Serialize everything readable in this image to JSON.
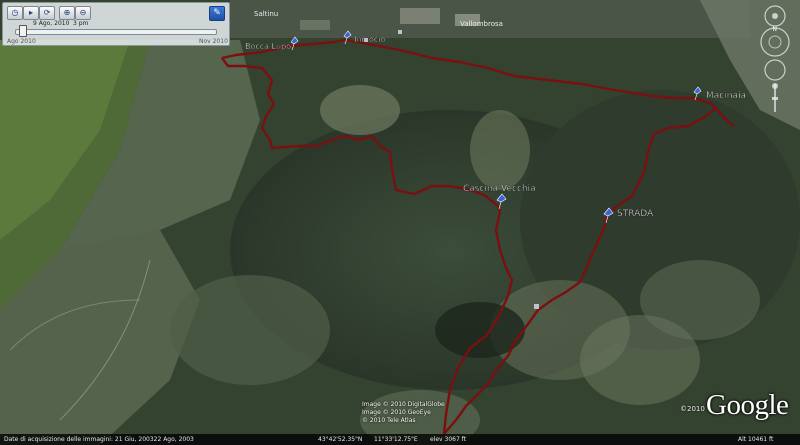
{
  "time_slider": {
    "date": "9 Ago, 2010",
    "time": "3 pm",
    "start_label": "Ago 2010",
    "end_label": "Nov 2010"
  },
  "places": {
    "sallinu": "Saltinu",
    "vallombrosa": "Vallombrosa"
  },
  "placemarks": [
    {
      "label": "Bocca Lupo"
    },
    {
      "label": "Incrocio"
    },
    {
      "label": "Macinaia"
    },
    {
      "label": "Cascina Vecchia"
    },
    {
      "label": "STRADA"
    }
  ],
  "credits": {
    "line1": "Image © 2010 DigitalGlobe",
    "line2": "Image © 2010 GeoEye",
    "line3": "© 2010 Tele Atlas"
  },
  "logo": {
    "text": "Google",
    "year": "©2010"
  },
  "status_bar": {
    "imagery_date": "Date di acquisizione delle immagini: 21 Giu, 200322 Ago, 2003",
    "latitude": "43°42'52.35\"N",
    "longitude": "11°33'12.75\"E",
    "elevation": "elev  3067 ft",
    "eye_alt": "Alt  10461 ft"
  },
  "colors": {
    "track": "#7a1010",
    "placemark": "#3b63d8",
    "terrain_dark": "#2c3a2d",
    "terrain_light": "#5d6e58"
  },
  "icons": {
    "placemark": "pushpin-icon",
    "compass": "compass-icon",
    "zoom": "zoom-slider-icon"
  }
}
